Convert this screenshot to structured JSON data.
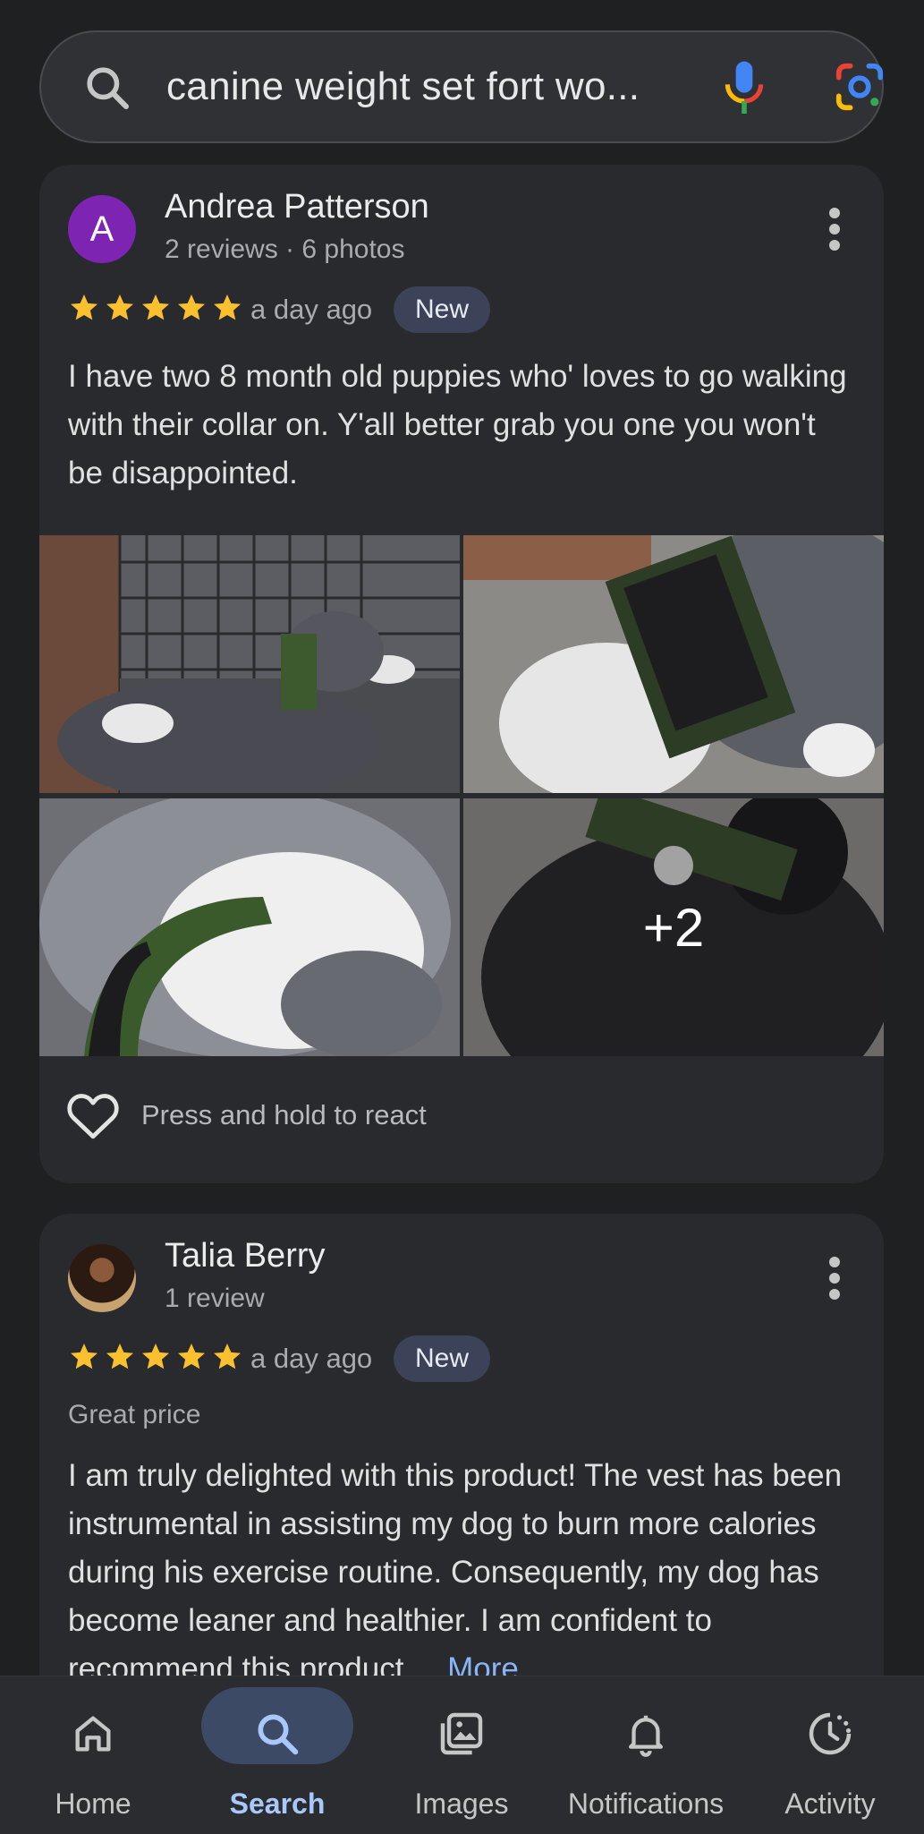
{
  "search": {
    "query": "canine weight set fort wo..."
  },
  "reviews": [
    {
      "avatar_letter": "A",
      "name": "Andrea Patterson",
      "meta": "2 reviews · 6 photos",
      "rating": 5,
      "when": "a day ago",
      "badge": "New",
      "text": "I have two 8 month old puppies who' loves to go walking with their collar on. Y'all better grab you one you won't be disappointed.",
      "extra_photos": "+2",
      "react_label": "Press and hold to react"
    },
    {
      "name": "Talia Berry",
      "meta": "1 review",
      "rating": 5,
      "when": "a day ago",
      "badge": "New",
      "subtitle": "Great price",
      "text": "I am truly delighted with this product! The vest has been instrumental in assisting my dog to burn more calories during his exercise routine. Consequently, my dog has become leaner and healthier. I am confident to recommend this product ...",
      "more_label": "More"
    }
  ],
  "nav": {
    "home": "Home",
    "search": "Search",
    "images": "Images",
    "notifications": "Notifications",
    "activity": "Activity"
  },
  "colors": {
    "background": "#1f2022",
    "card": "#292a2d",
    "star": "#fbc02d",
    "accent": "#a8c7fa",
    "badge": "#3c4257"
  }
}
